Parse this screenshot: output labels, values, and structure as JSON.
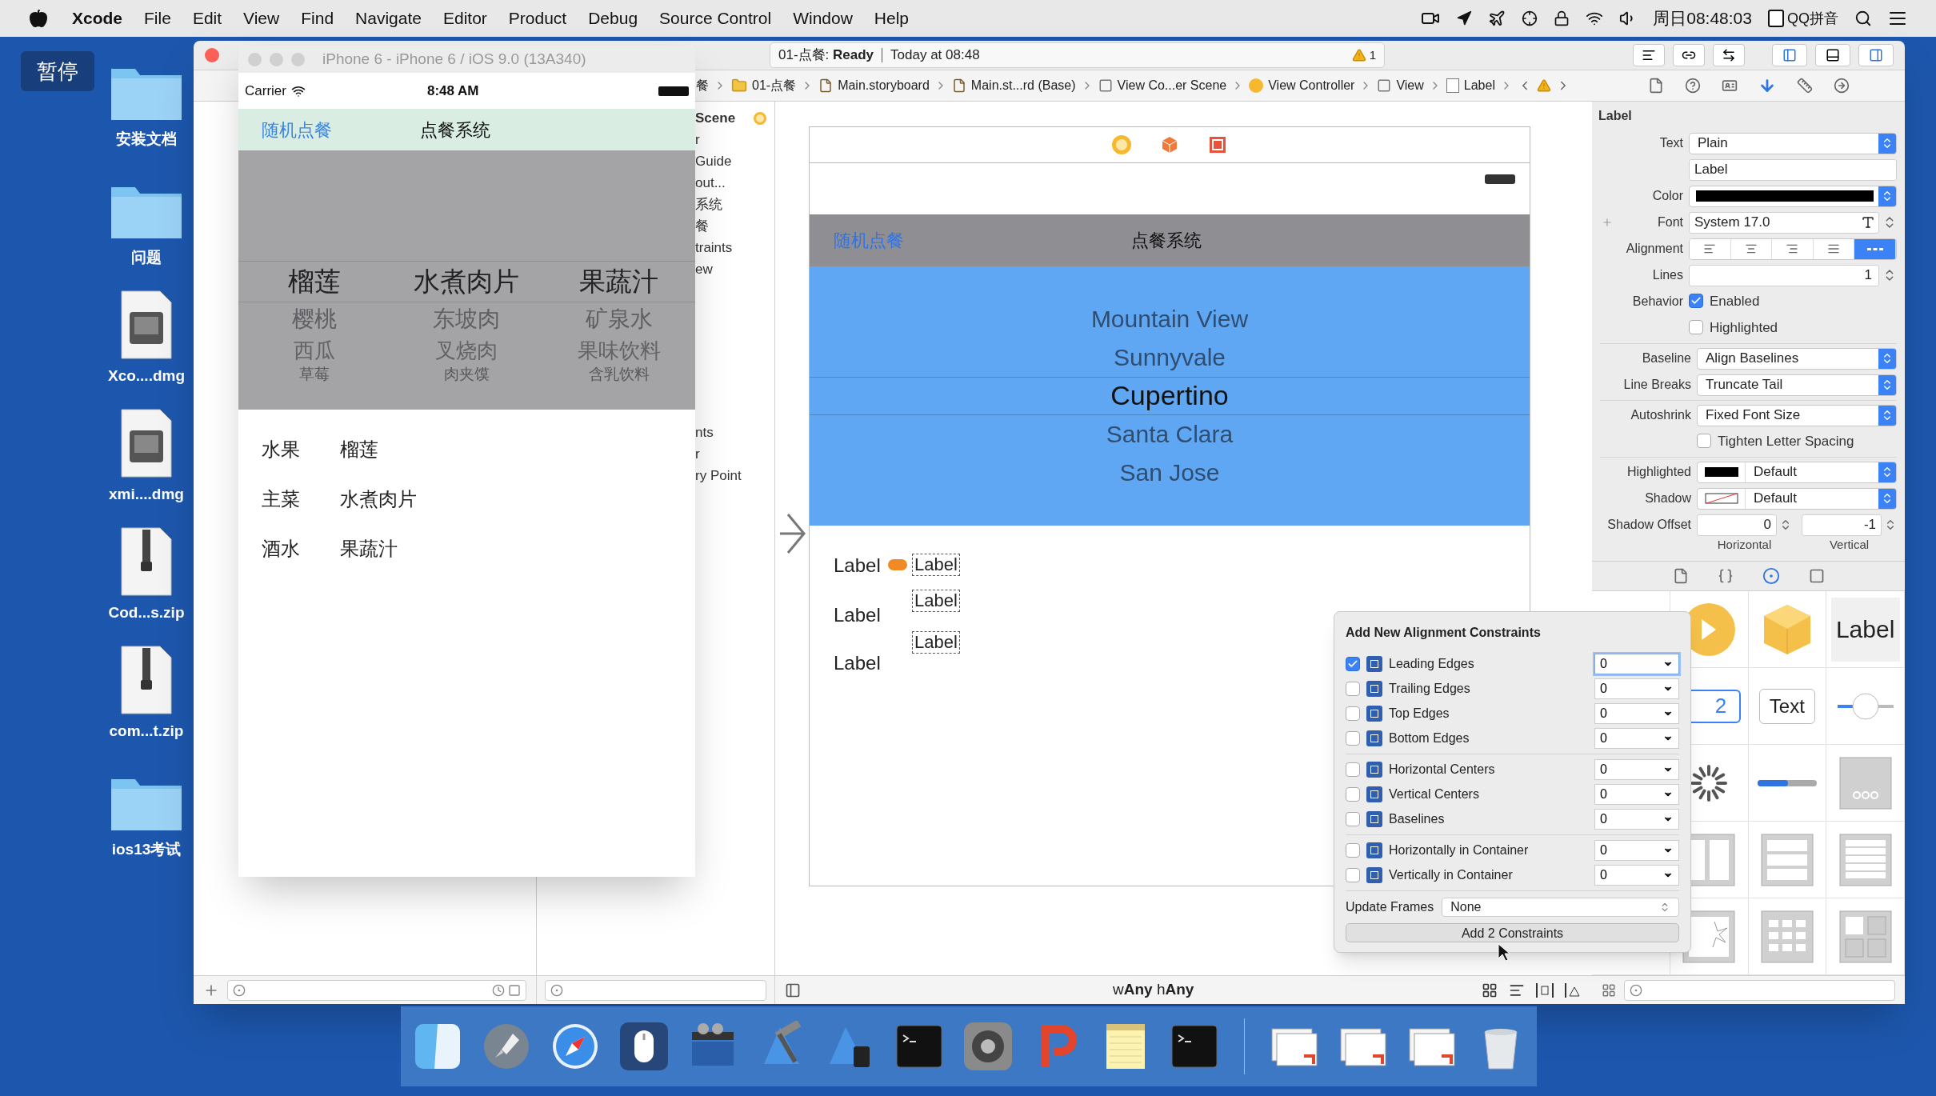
{
  "menu_bar": {
    "app": "Xcode",
    "items": [
      "File",
      "Edit",
      "View",
      "Find",
      "Navigate",
      "Editor",
      "Product",
      "Debug",
      "Source Control",
      "Window",
      "Help"
    ],
    "clock": "周日08:48:03",
    "input_method": "QQ拼音"
  },
  "desktop": {
    "badge": "暂停",
    "icons": [
      {
        "label": "安装文档",
        "kind": "folder"
      },
      {
        "label": "问题",
        "kind": "folder"
      },
      {
        "label": "Xco....dmg",
        "kind": "disk"
      },
      {
        "label": "xmi....dmg",
        "kind": "disk"
      },
      {
        "label": "Cod...s.zip",
        "kind": "zip"
      },
      {
        "label": "com...t.zip",
        "kind": "zip"
      },
      {
        "label": "ios13考试",
        "kind": "folder"
      }
    ]
  },
  "simulator": {
    "title": "iPhone 6 - iPhone 6 / iOS 9.0 (13A340)",
    "carrier": "Carrier",
    "time": "8:48 AM",
    "nav_button": "随机点餐",
    "nav_title": "点餐系统",
    "picker_columns": [
      [
        {
          "label": "榴莲",
          "selected": true
        },
        {
          "label": "樱桃",
          "selected": false
        },
        {
          "label": "西瓜",
          "selected": false
        },
        {
          "label": "草莓",
          "selected": false
        }
      ],
      [
        {
          "label": "水煮肉片",
          "selected": true
        },
        {
          "label": "东坡肉",
          "selected": false
        },
        {
          "label": "叉烧肉",
          "selected": false
        },
        {
          "label": "肉夹馍",
          "selected": false
        }
      ],
      [
        {
          "label": "果蔬汁",
          "selected": true
        },
        {
          "label": "矿泉水",
          "selected": false
        },
        {
          "label": "果味饮料",
          "selected": false
        },
        {
          "label": "含乳饮料",
          "selected": false
        }
      ]
    ],
    "results": [
      {
        "category": "水果",
        "value": "榴莲"
      },
      {
        "category": "主菜",
        "value": "水煮肉片"
      },
      {
        "category": "酒水",
        "value": "果蔬汁"
      }
    ]
  },
  "toolbar": {
    "status": "01-点餐: **Ready**",
    "time": "Today at 08:48",
    "warnings": "1"
  },
  "breadcrumbs": [
    {
      "label": "餐",
      "kind": "folder"
    },
    {
      "label": "01-点餐",
      "kind": "folder"
    },
    {
      "label": "Main.storyboard",
      "kind": "file"
    },
    {
      "label": "Main.st...rd (Base)",
      "kind": "file"
    },
    {
      "label": "View Co...er Scene",
      "kind": "scene"
    },
    {
      "label": "View Controller",
      "kind": "controller"
    },
    {
      "label": "View",
      "kind": "view"
    },
    {
      "label": "Label",
      "kind": "label"
    }
  ],
  "outline": [
    {
      "label": "Scene",
      "kind": "scene"
    },
    {
      "label": "r",
      "kind": "item"
    },
    {
      "label": "Guide",
      "kind": "item"
    },
    {
      "label": "out...",
      "kind": "item"
    },
    {
      "label": "系统",
      "kind": "item"
    },
    {
      "label": "餐",
      "kind": "item"
    },
    {
      "label": "traints",
      "kind": "item"
    },
    {
      "label": "ew",
      "kind": "item"
    },
    {
      "label": "nts",
      "kind": "item"
    },
    {
      "label": "r",
      "kind": "item"
    },
    {
      "label": "ry Point",
      "kind": "item"
    }
  ],
  "canvas": {
    "nav_button": "随机点餐",
    "nav_title": "点餐系统",
    "picker": [
      {
        "label": "Mountain View",
        "selected": false
      },
      {
        "label": "Sunnyvale",
        "selected": false
      },
      {
        "label": "Cupertino",
        "selected": true
      },
      {
        "label": "Santa Clara",
        "selected": false
      },
      {
        "label": "San Jose",
        "selected": false
      }
    ],
    "labels": [
      {
        "text": "Label",
        "selected": false
      },
      {
        "text": "Label",
        "selected": false
      },
      {
        "text": "Label",
        "selected": false
      },
      {
        "text": "Label",
        "selected": true
      },
      {
        "text": "Label",
        "selected": true
      },
      {
        "text": "Label",
        "selected": true
      }
    ],
    "size_class": "w**Any** h**Any**"
  },
  "inspector": {
    "title": "Label",
    "sections": [
      [
        {
          "kind": "select",
          "label": "Text",
          "value": "Plain"
        },
        {
          "kind": "text",
          "value": "Label"
        },
        {
          "kind": "color",
          "label": "Color",
          "color": "#000000"
        },
        {
          "kind": "font",
          "label": "Font",
          "value": "System 17.0"
        },
        {
          "kind": "alignment",
          "label": "Alignment",
          "options": [
            {
              "kind": "left",
              "selected": false
            },
            {
              "kind": "center",
              "selected": false
            },
            {
              "kind": "right",
              "selected": false
            },
            {
              "kind": "justified",
              "selected": false
            },
            {
              "kind": "natural",
              "selected": true
            }
          ]
        },
        {
          "kind": "stepper",
          "label": "Lines",
          "value": "1"
        },
        {
          "kind": "checkbox",
          "label": "Behavior",
          "text": "Enabled",
          "checked": true
        },
        {
          "kind": "checkbox",
          "text": "Highlighted",
          "checked": false
        }
      ],
      [
        {
          "kind": "select",
          "label": "Baseline",
          "value": "Align Baselines"
        },
        {
          "kind": "select",
          "label": "Line Breaks",
          "value": "Truncate Tail"
        }
      ],
      [
        {
          "kind": "select",
          "label": "Autoshrink",
          "value": "Fixed Font Size"
        },
        {
          "kind": "checkbox",
          "text": "Tighten Letter Spacing",
          "checked": false
        }
      ],
      [
        {
          "kind": "swatch_select",
          "label": "Highlighted",
          "color": "#000000",
          "value": "Default"
        },
        {
          "kind": "swatch_select",
          "label": "Shadow",
          "value": "Default"
        },
        {
          "kind": "offset",
          "label": "Shadow Offset",
          "fields": [
            {
              "value": "0",
              "caption": "Horizontal"
            },
            {
              "value": "-1",
              "caption": "Vertical"
            }
          ]
        }
      ]
    ]
  },
  "library": [
    {
      "kind": "play"
    },
    {
      "kind": "cube"
    },
    {
      "kind": "text",
      "label": "Label"
    },
    {
      "kind": "segmented",
      "label": "2"
    },
    {
      "kind": "button",
      "label": "Text"
    },
    {
      "kind": "slider"
    },
    {
      "kind": "spinner"
    },
    {
      "kind": "progress"
    },
    {
      "kind": "page"
    },
    {
      "kind": "columns"
    },
    {
      "kind": "table"
    },
    {
      "kind": "list"
    },
    {
      "kind": "image"
    },
    {
      "kind": "grid"
    },
    {
      "kind": "container"
    }
  ],
  "popover": {
    "title": "Add New Alignment Constraints",
    "groups": [
      [
        {
          "label": "Leading Edges",
          "checked": true,
          "value": "0",
          "focused": true
        },
        {
          "label": "Trailing Edges",
          "checked": false,
          "value": "0",
          "focused": false
        },
        {
          "label": "Top Edges",
          "checked": false,
          "value": "0",
          "focused": false
        },
        {
          "label": "Bottom Edges",
          "checked": false,
          "value": "0",
          "focused": false
        }
      ],
      [
        {
          "label": "Horizontal Centers",
          "checked": false,
          "value": "0",
          "focused": false
        },
        {
          "label": "Vertical Centers",
          "checked": false,
          "value": "0",
          "focused": false
        },
        {
          "label": "Baselines",
          "checked": false,
          "value": "0",
          "focused": false
        }
      ],
      [
        {
          "label": "Horizontally in Container",
          "checked": false,
          "value": "0",
          "focused": false
        },
        {
          "label": "Vertically in Container",
          "checked": false,
          "value": "0",
          "focused": false
        }
      ]
    ],
    "update_label": "Update Frames",
    "update_value": "None",
    "button": "Add 2 Constraints"
  },
  "dock": [
    {
      "kind": "finder"
    },
    {
      "kind": "rocket"
    },
    {
      "kind": "compass"
    },
    {
      "kind": "mouse"
    },
    {
      "kind": "clapper"
    },
    {
      "kind": "hammer"
    },
    {
      "kind": "blueprint"
    },
    {
      "kind": "terminal"
    },
    {
      "kind": "gear"
    },
    {
      "kind": "hook"
    },
    {
      "kind": "notes"
    },
    {
      "kind": "terminal"
    },
    {
      "kind": "separator"
    },
    {
      "kind": "docs"
    },
    {
      "kind": "docs"
    },
    {
      "kind": "docs"
    },
    {
      "kind": "trash"
    }
  ]
}
